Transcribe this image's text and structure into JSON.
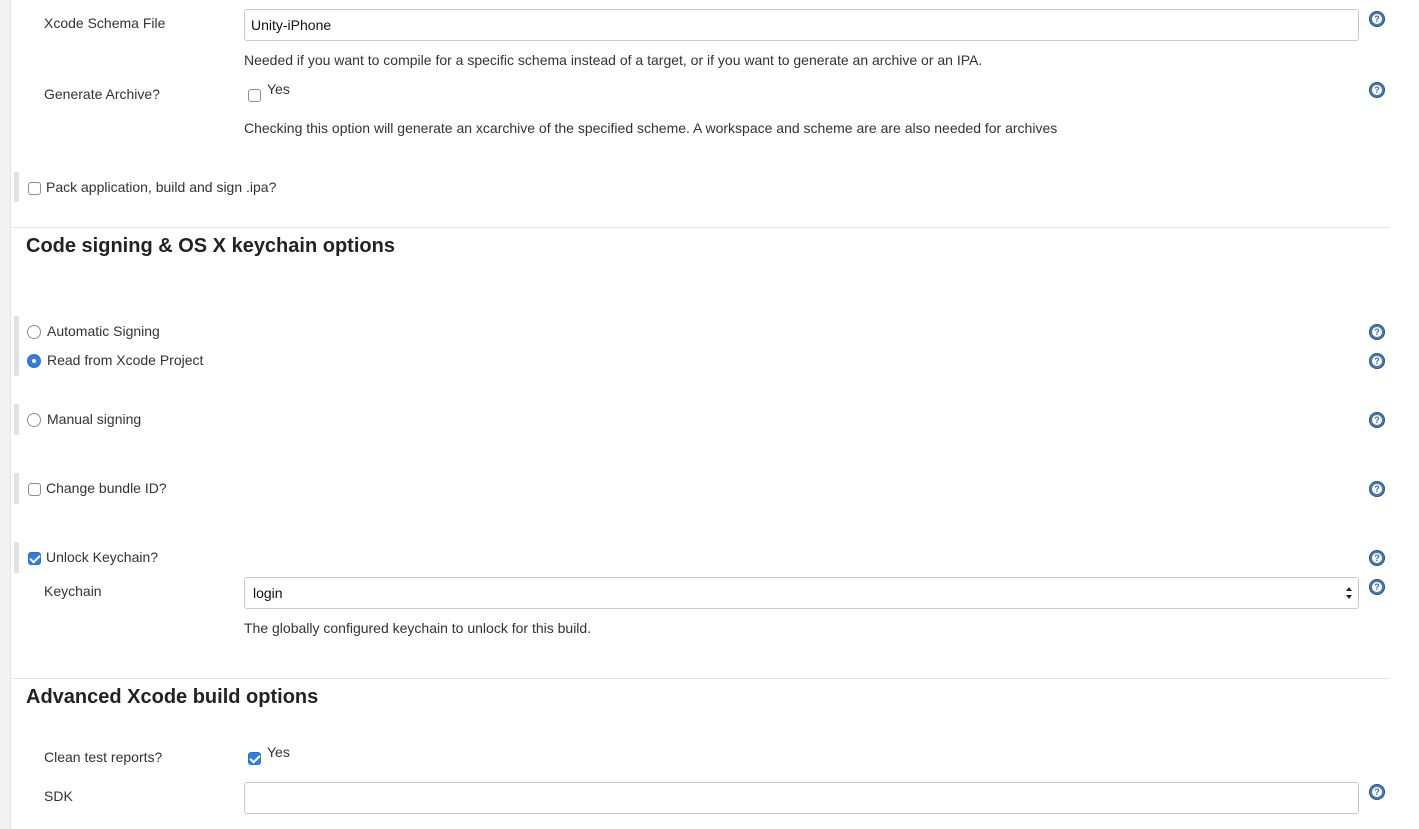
{
  "xcode_schema": {
    "label": "Xcode Schema File",
    "value": "Unity-iPhone",
    "description": "Needed if you want to compile for a specific schema instead of a target, or if you want to generate an archive or an IPA."
  },
  "generate_archive": {
    "label": "Generate Archive?",
    "option_label": "Yes",
    "checked": false,
    "description": "Checking this option will generate an xcarchive of the specified scheme. A workspace and scheme are are also needed for archives"
  },
  "pack_ipa": {
    "label": "Pack application, build and sign .ipa?",
    "checked": false
  },
  "code_signing": {
    "title": "Code signing & OS X keychain options",
    "automatic_signing": "Automatic Signing",
    "read_from_project": "Read from Xcode Project",
    "manual_signing": "Manual signing",
    "selected": "Read from Xcode Project",
    "change_bundle_id": "Change bundle ID?",
    "unlock_keychain": "Unlock Keychain?",
    "unlock_keychain_checked": true,
    "keychain_label": "Keychain",
    "keychain_value": "login",
    "keychain_description": "The globally configured keychain to unlock for this build."
  },
  "advanced": {
    "title": "Advanced Xcode build options",
    "clean_test_reports_label": "Clean test reports?",
    "clean_test_reports_option": "Yes",
    "clean_test_reports_checked": true,
    "sdk_label": "SDK",
    "sdk_value": ""
  },
  "icons": {
    "help": "help-icon",
    "help_glyph": "?"
  },
  "colors": {
    "accent": "#2f7de1",
    "help": "#4a79b0"
  }
}
